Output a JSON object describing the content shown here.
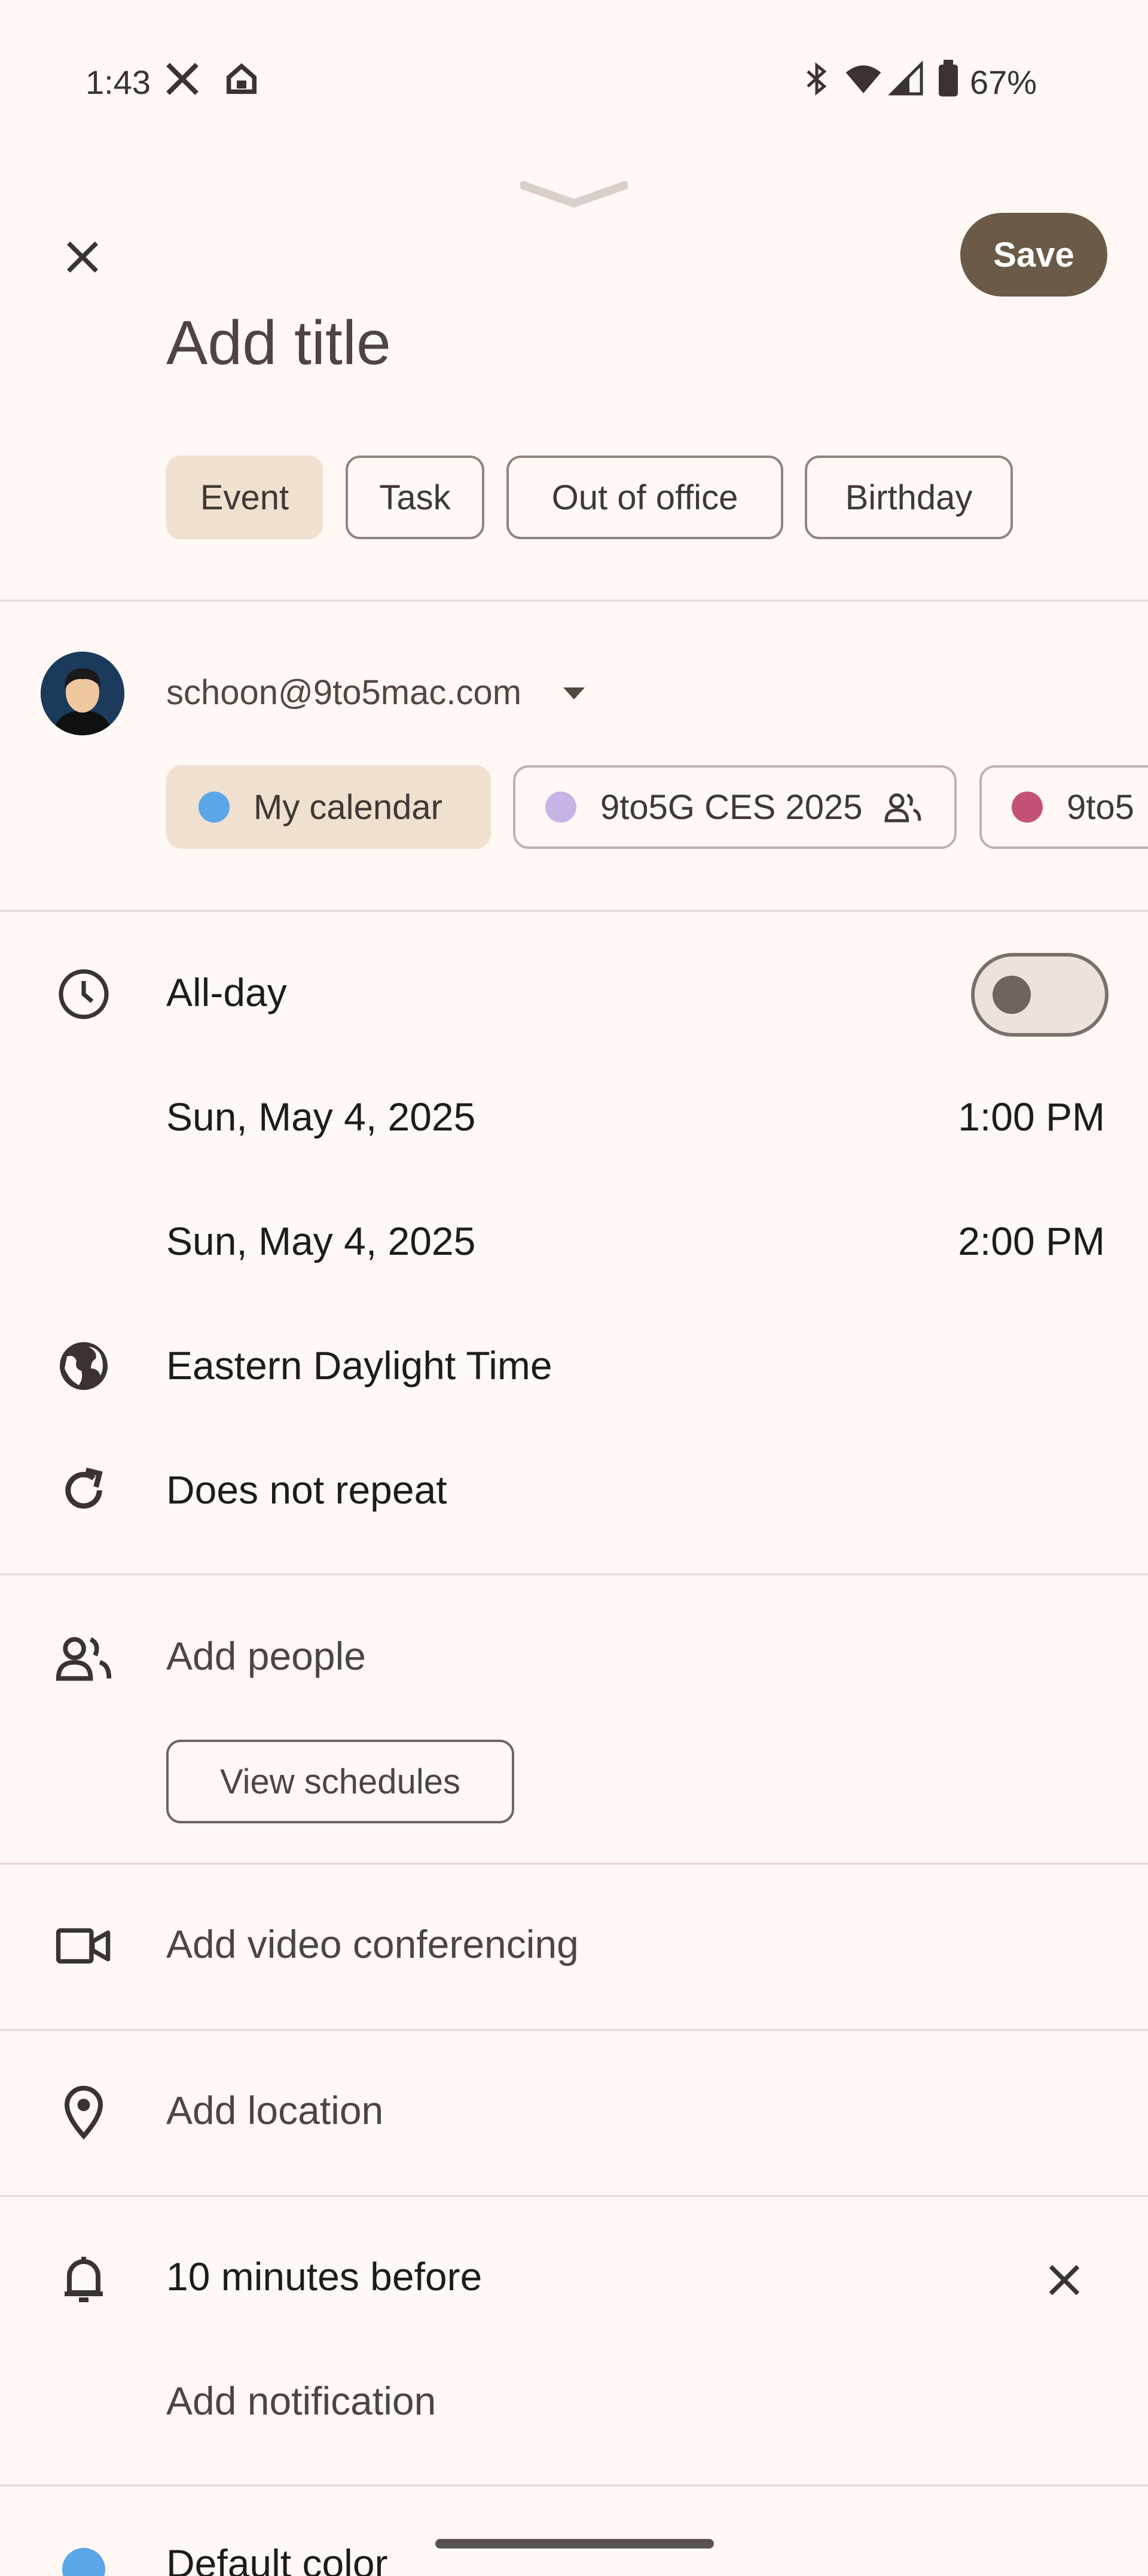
{
  "status_bar": {
    "time": "1:43",
    "battery": "67%",
    "icons": [
      "x-icon",
      "home-icon",
      "bluetooth-icon",
      "wifi-icon",
      "signal-icon",
      "battery-icon"
    ]
  },
  "header": {
    "save_label": "Save",
    "title_placeholder": "Add title"
  },
  "type_chips": [
    {
      "label": "Event",
      "selected": true
    },
    {
      "label": "Task",
      "selected": false
    },
    {
      "label": "Out of office",
      "selected": false
    },
    {
      "label": "Birthday",
      "selected": false
    }
  ],
  "account": {
    "email": "schoon@9to5mac.com"
  },
  "calendars": [
    {
      "label": "My calendar",
      "color": "#5AA6E8",
      "selected": true
    },
    {
      "label": "9to5G CES 2025",
      "color": "#C7B4E6",
      "selected": false,
      "shared": true
    },
    {
      "label": "9to5",
      "color": "#C45277",
      "selected": false
    }
  ],
  "time_section": {
    "all_day_label": "All-day",
    "all_day_on": false,
    "start_date": "Sun, May 4, 2025",
    "start_time": "1:00 PM",
    "end_date": "Sun, May 4, 2025",
    "end_time": "2:00 PM",
    "timezone": "Eastern Daylight Time",
    "repeat": "Does not repeat"
  },
  "people": {
    "add_people_label": "Add people",
    "view_schedules_label": "View schedules"
  },
  "video": {
    "label": "Add video conferencing"
  },
  "location": {
    "label": "Add location"
  },
  "notifications": {
    "current": "10 minutes before",
    "add_label": "Add notification"
  },
  "color": {
    "label": "Default color",
    "value": "#5AA6E8"
  }
}
